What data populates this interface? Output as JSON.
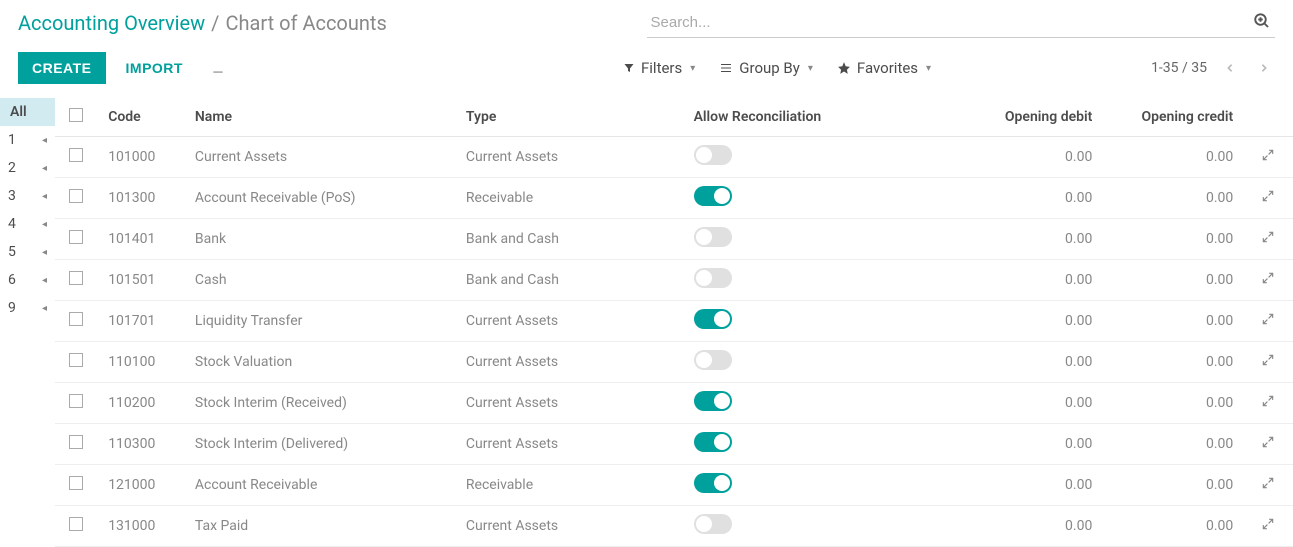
{
  "breadcrumb": {
    "parent": "Accounting Overview",
    "current": "Chart of Accounts"
  },
  "search": {
    "placeholder": "Search..."
  },
  "toolbar": {
    "create_label": "CREATE",
    "import_label": "IMPORT",
    "filters_label": "Filters",
    "groupby_label": "Group By",
    "favorites_label": "Favorites",
    "pager": "1-35 / 35"
  },
  "sidebar": {
    "all_label": "All",
    "items": [
      "1",
      "2",
      "3",
      "4",
      "5",
      "6",
      "9"
    ]
  },
  "columns": {
    "code": "Code",
    "name": "Name",
    "type": "Type",
    "reconciliation": "Allow Reconciliation",
    "opening_debit": "Opening debit",
    "opening_credit": "Opening credit"
  },
  "rows": [
    {
      "code": "101000",
      "name": "Current Assets",
      "type": "Current Assets",
      "reconcile": false,
      "debit": "0.00",
      "credit": "0.00"
    },
    {
      "code": "101300",
      "name": "Account Receivable (PoS)",
      "type": "Receivable",
      "reconcile": true,
      "debit": "0.00",
      "credit": "0.00"
    },
    {
      "code": "101401",
      "name": "Bank",
      "type": "Bank and Cash",
      "reconcile": false,
      "debit": "0.00",
      "credit": "0.00"
    },
    {
      "code": "101501",
      "name": "Cash",
      "type": "Bank and Cash",
      "reconcile": false,
      "debit": "0.00",
      "credit": "0.00"
    },
    {
      "code": "101701",
      "name": "Liquidity Transfer",
      "type": "Current Assets",
      "reconcile": true,
      "debit": "0.00",
      "credit": "0.00"
    },
    {
      "code": "110100",
      "name": "Stock Valuation",
      "type": "Current Assets",
      "reconcile": false,
      "debit": "0.00",
      "credit": "0.00"
    },
    {
      "code": "110200",
      "name": "Stock Interim (Received)",
      "type": "Current Assets",
      "reconcile": true,
      "debit": "0.00",
      "credit": "0.00"
    },
    {
      "code": "110300",
      "name": "Stock Interim (Delivered)",
      "type": "Current Assets",
      "reconcile": true,
      "debit": "0.00",
      "credit": "0.00"
    },
    {
      "code": "121000",
      "name": "Account Receivable",
      "type": "Receivable",
      "reconcile": true,
      "debit": "0.00",
      "credit": "0.00"
    },
    {
      "code": "131000",
      "name": "Tax Paid",
      "type": "Current Assets",
      "reconcile": false,
      "debit": "0.00",
      "credit": "0.00"
    }
  ]
}
